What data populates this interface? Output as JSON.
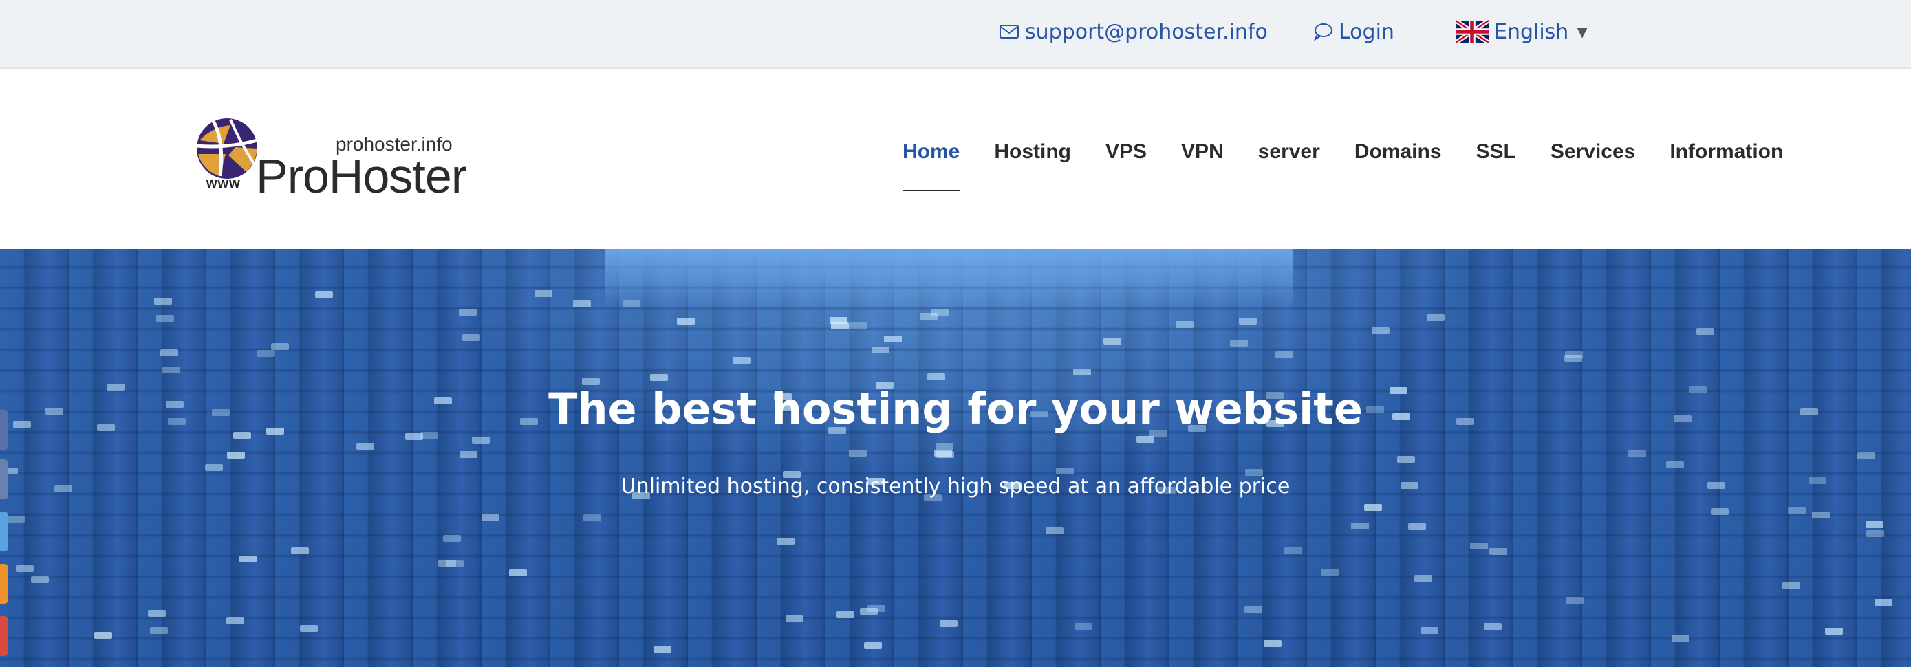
{
  "topbar": {
    "email": "support@prohoster.info",
    "login": "Login",
    "language": "English",
    "email_icon": "envelope-icon",
    "login_icon": "speech-bubble-icon",
    "language_icon": "uk-flag-icon"
  },
  "logo": {
    "domain": "prohoster.info",
    "name": "ProHoster",
    "www": "www"
  },
  "nav": {
    "items": [
      "Home",
      "Hosting",
      "VPS",
      "VPN",
      "server",
      "Domains",
      "SSL",
      "Services",
      "Information"
    ],
    "active": "Home"
  },
  "hero": {
    "title": "The best hosting for your website",
    "subtitle": "Unlimited hosting, consistently high speed at an affordable price"
  },
  "social_tabs": [
    {
      "name": "facebook",
      "color": "#5b6fa8"
    },
    {
      "name": "vk",
      "color": "#6a80ad"
    },
    {
      "name": "twitter",
      "color": "#5aa3de"
    },
    {
      "name": "odnoklassniki",
      "color": "#f0922a"
    },
    {
      "name": "youtube",
      "color": "#d94a3e"
    }
  ],
  "colors": {
    "accent": "#2754a6",
    "topbar_bg": "#eef2f5",
    "hero_bg": "#2a5aa3"
  }
}
